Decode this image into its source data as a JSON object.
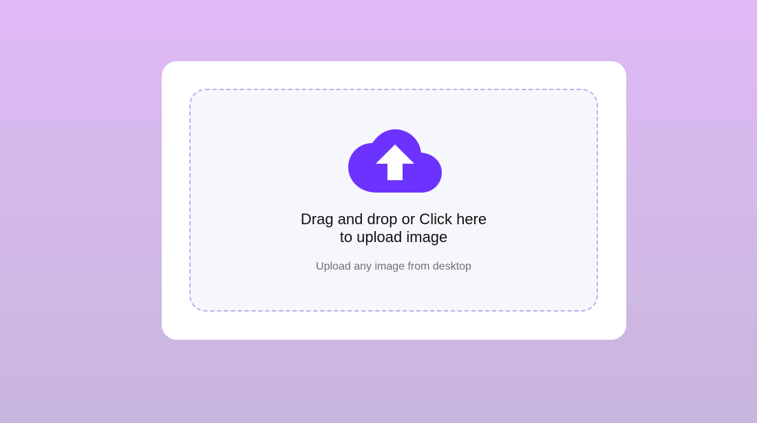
{
  "upload": {
    "title_line1": "Drag and drop or Click here",
    "title_line2": "to upload image",
    "subtitle": "Upload any image from desktop",
    "icon": "cloud-upload-icon"
  },
  "colors": {
    "accent": "#6c33ff",
    "dropzone_border": "#b9b0f0",
    "dropzone_bg": "#f6f6fd",
    "background_top": "#e0b9f7",
    "background_bottom": "#c8b6dd"
  }
}
